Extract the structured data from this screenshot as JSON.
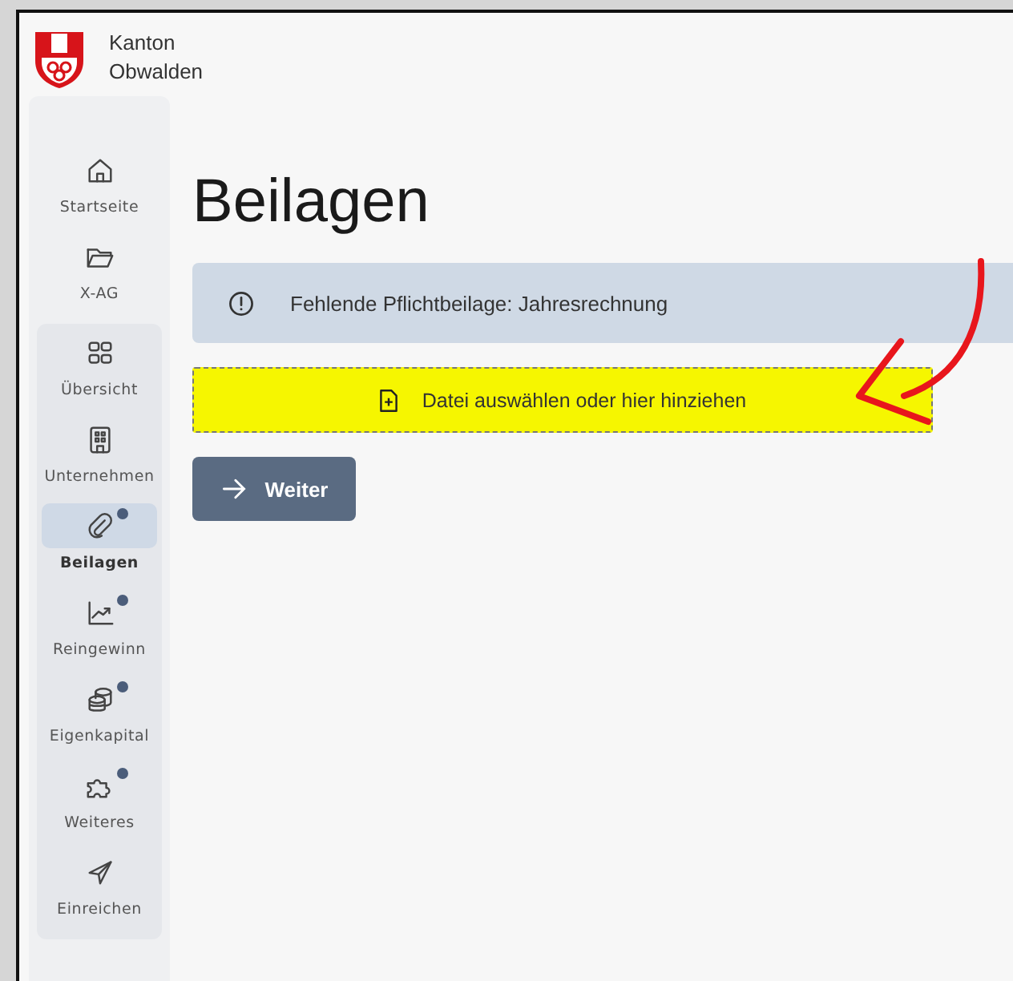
{
  "brand": {
    "line1": "Kanton",
    "line2": "Obwalden"
  },
  "nav": {
    "top": [
      {
        "label": "Startseite",
        "kind": "home",
        "dot": false,
        "selected": false
      },
      {
        "label": "X-AG",
        "kind": "folder",
        "dot": false,
        "selected": false
      }
    ],
    "steps": [
      {
        "label": "Übersicht",
        "kind": "grid",
        "dot": false,
        "selected": false
      },
      {
        "label": "Unternehmen",
        "kind": "building",
        "dot": false,
        "selected": false
      },
      {
        "label": "Beilagen",
        "kind": "clip",
        "dot": true,
        "selected": true
      },
      {
        "label": "Reingewinn",
        "kind": "chart",
        "dot": true,
        "selected": false
      },
      {
        "label": "Eigenkapital",
        "kind": "coins",
        "dot": true,
        "selected": false
      },
      {
        "label": "Weiteres",
        "kind": "puzzle",
        "dot": true,
        "selected": false
      },
      {
        "label": "Einreichen",
        "kind": "send",
        "dot": false,
        "selected": false
      }
    ]
  },
  "page": {
    "title": "Beilagen",
    "alert": "Fehlende Pflichtbeilage: Jahresrechnung",
    "dropzone": "Datei auswählen oder hier hinziehen",
    "button": "Weiter"
  }
}
